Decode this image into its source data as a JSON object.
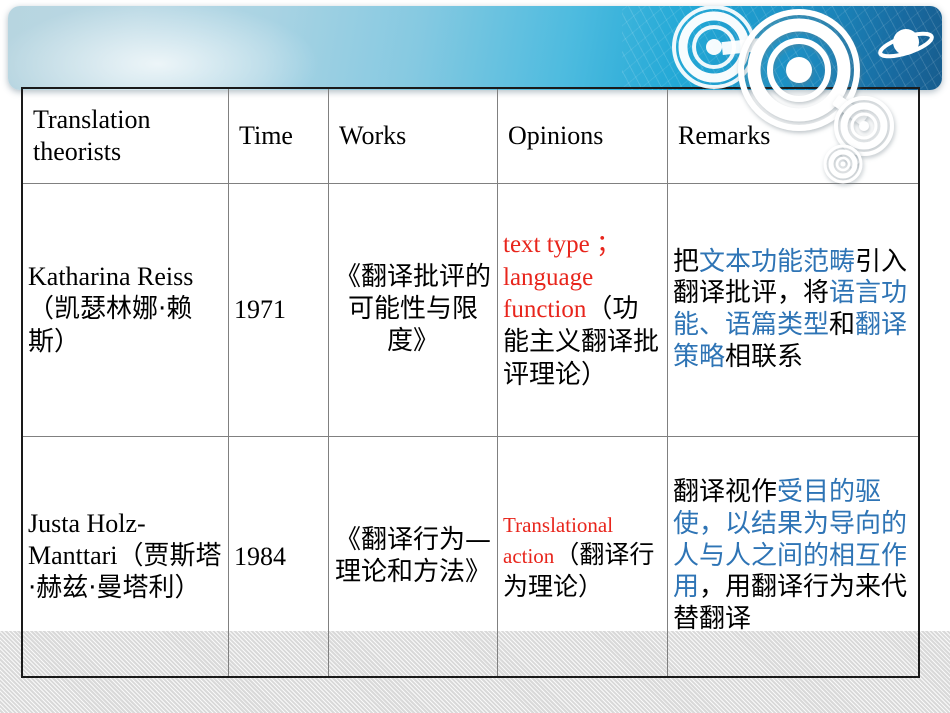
{
  "slide": {
    "banner": {
      "gradient_from": "#b7d5e0",
      "gradient_to": "#175d8e",
      "decor_icons": [
        "concentric-rings-large",
        "concentric-rings-medium",
        "concentric-rings-small",
        "saturn-planet"
      ]
    },
    "accent_colors": {
      "english_term": "#e8251c",
      "highlight": "#2e74b5",
      "body_text": "#000000",
      "table_border": "#808080",
      "table_frame": "#1a1a1a"
    }
  },
  "table": {
    "headers": [
      "Translation theorists",
      "Time",
      "Works",
      "Opinions",
      "Remarks"
    ],
    "rows": [
      {
        "theorist": "Katharina Reiss （凯瑟林娜·赖斯）",
        "theorist_en": "Katharina Reiss",
        "theorist_cn": "（凯瑟林娜·赖斯）",
        "time": "1971",
        "works": "《翻译批评的可能性与限度》",
        "opinions_en": "text type ；language function",
        "opinions_cn": "（功能主义翻译批评理论）",
        "remarks_parts": [
          {
            "text": "把",
            "highlight": false
          },
          {
            "text": "文本功能范畴",
            "highlight": true
          },
          {
            "text": "引入翻译批评，将",
            "highlight": false
          },
          {
            "text": "语言功能、语篇类型",
            "highlight": true
          },
          {
            "text": "和",
            "highlight": false
          },
          {
            "text": "翻译策略",
            "highlight": true
          },
          {
            "text": "相联系",
            "highlight": false
          }
        ]
      },
      {
        "theorist": "Justa Holz-Manttari （贾斯塔·赫兹·曼塔利）",
        "theorist_en": "Justa Holz-Manttari",
        "theorist_cn": "（贾斯塔·赫兹·曼塔利）",
        "time": "1984",
        "works": "《翻译行为—理论和方法》",
        "opinions_en": "Translational action",
        "opinions_cn": "（翻译行为理论）",
        "remarks_parts": [
          {
            "text": "翻译视作",
            "highlight": false
          },
          {
            "text": "受目的驱使，以结果为导向的人与人之间的相互作用",
            "highlight": true
          },
          {
            "text": "，用翻译行为来代替翻译",
            "highlight": false
          }
        ]
      }
    ]
  }
}
